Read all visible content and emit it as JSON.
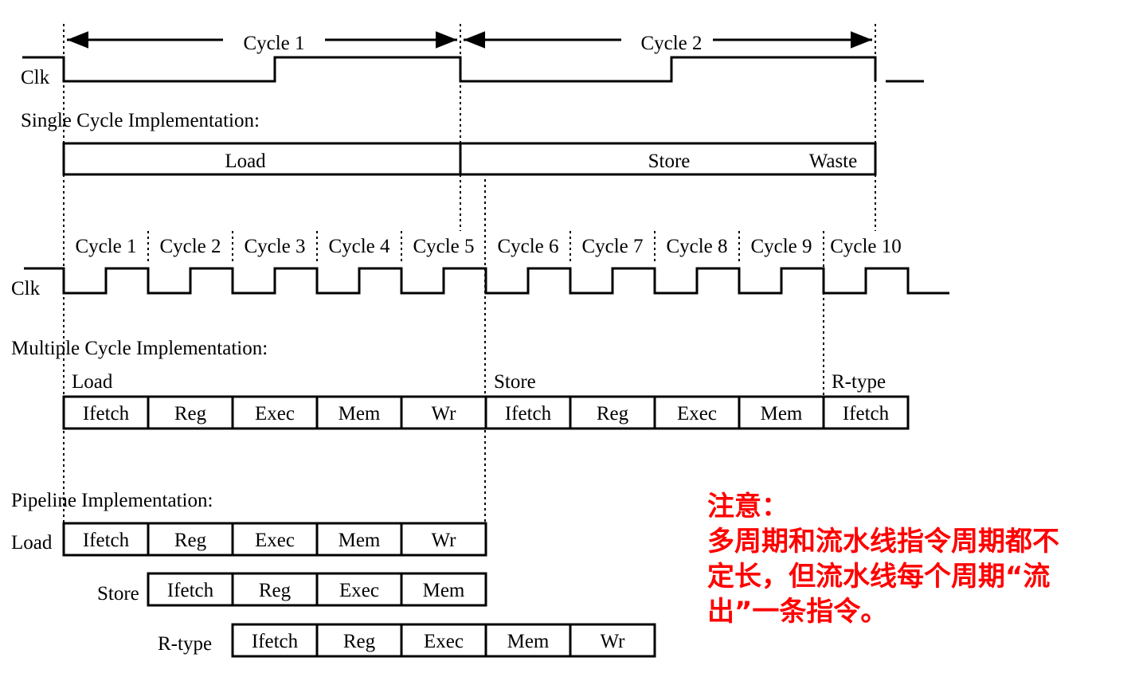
{
  "clk_label": "Clk",
  "single": {
    "title": "Single Cycle Implementation:",
    "cycles": [
      "Cycle 1",
      "Cycle 2"
    ],
    "segments": [
      "Load",
      "Store",
      "Waste"
    ]
  },
  "multi": {
    "cycles": [
      "Cycle 1",
      "Cycle 2",
      "Cycle 3",
      "Cycle 4",
      "Cycle 5",
      "Cycle 6",
      "Cycle 7",
      "Cycle 8",
      "Cycle 9",
      "Cycle 10"
    ],
    "title": "Multiple Cycle Implementation:",
    "instructions": [
      "Load",
      "Store",
      "R-type"
    ],
    "stages": [
      "Ifetch",
      "Reg",
      "Exec",
      "Mem",
      "Wr",
      "Ifetch",
      "Reg",
      "Exec",
      "Mem",
      "Ifetch"
    ]
  },
  "pipeline": {
    "title": "Pipeline Implementation:",
    "rows": [
      {
        "label": "Load",
        "stages": [
          "Ifetch",
          "Reg",
          "Exec",
          "Mem",
          "Wr"
        ]
      },
      {
        "label": "Store",
        "stages": [
          "Ifetch",
          "Reg",
          "Exec",
          "Mem"
        ]
      },
      {
        "label": "R-type",
        "stages": [
          "Ifetch",
          "Reg",
          "Exec",
          "Mem",
          "Wr"
        ]
      }
    ]
  },
  "note": {
    "title": "注意：",
    "lines": [
      "多周期和流水线指令周期都不",
      "定长，但流水线每个周期“流",
      "出”一条指令。"
    ]
  }
}
